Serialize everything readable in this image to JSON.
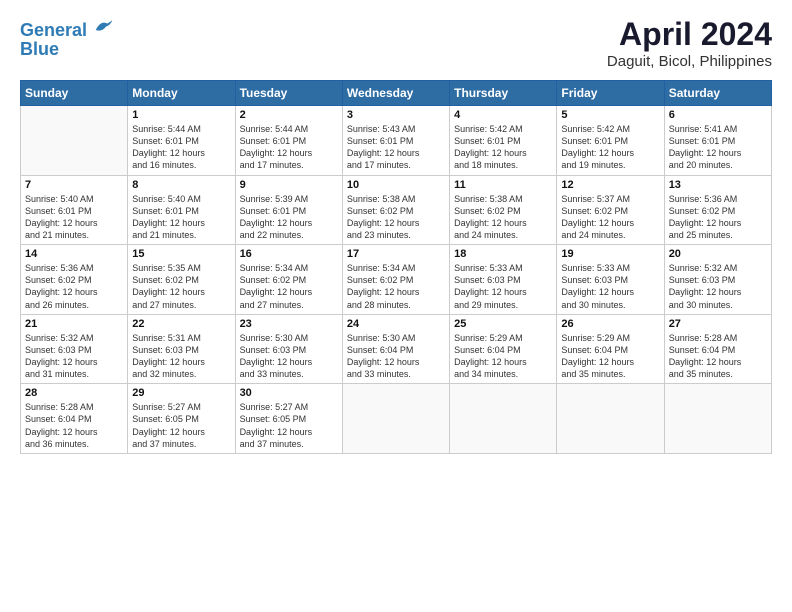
{
  "header": {
    "logo_line1": "General",
    "logo_line2": "Blue",
    "title": "April 2024",
    "subtitle": "Daguit, Bicol, Philippines"
  },
  "days_of_week": [
    "Sunday",
    "Monday",
    "Tuesday",
    "Wednesday",
    "Thursday",
    "Friday",
    "Saturday"
  ],
  "weeks": [
    [
      {
        "day": "",
        "info": ""
      },
      {
        "day": "1",
        "info": "Sunrise: 5:44 AM\nSunset: 6:01 PM\nDaylight: 12 hours\nand 16 minutes."
      },
      {
        "day": "2",
        "info": "Sunrise: 5:44 AM\nSunset: 6:01 PM\nDaylight: 12 hours\nand 17 minutes."
      },
      {
        "day": "3",
        "info": "Sunrise: 5:43 AM\nSunset: 6:01 PM\nDaylight: 12 hours\nand 17 minutes."
      },
      {
        "day": "4",
        "info": "Sunrise: 5:42 AM\nSunset: 6:01 PM\nDaylight: 12 hours\nand 18 minutes."
      },
      {
        "day": "5",
        "info": "Sunrise: 5:42 AM\nSunset: 6:01 PM\nDaylight: 12 hours\nand 19 minutes."
      },
      {
        "day": "6",
        "info": "Sunrise: 5:41 AM\nSunset: 6:01 PM\nDaylight: 12 hours\nand 20 minutes."
      }
    ],
    [
      {
        "day": "7",
        "info": "Sunrise: 5:40 AM\nSunset: 6:01 PM\nDaylight: 12 hours\nand 21 minutes."
      },
      {
        "day": "8",
        "info": "Sunrise: 5:40 AM\nSunset: 6:01 PM\nDaylight: 12 hours\nand 21 minutes."
      },
      {
        "day": "9",
        "info": "Sunrise: 5:39 AM\nSunset: 6:01 PM\nDaylight: 12 hours\nand 22 minutes."
      },
      {
        "day": "10",
        "info": "Sunrise: 5:38 AM\nSunset: 6:02 PM\nDaylight: 12 hours\nand 23 minutes."
      },
      {
        "day": "11",
        "info": "Sunrise: 5:38 AM\nSunset: 6:02 PM\nDaylight: 12 hours\nand 24 minutes."
      },
      {
        "day": "12",
        "info": "Sunrise: 5:37 AM\nSunset: 6:02 PM\nDaylight: 12 hours\nand 24 minutes."
      },
      {
        "day": "13",
        "info": "Sunrise: 5:36 AM\nSunset: 6:02 PM\nDaylight: 12 hours\nand 25 minutes."
      }
    ],
    [
      {
        "day": "14",
        "info": "Sunrise: 5:36 AM\nSunset: 6:02 PM\nDaylight: 12 hours\nand 26 minutes."
      },
      {
        "day": "15",
        "info": "Sunrise: 5:35 AM\nSunset: 6:02 PM\nDaylight: 12 hours\nand 27 minutes."
      },
      {
        "day": "16",
        "info": "Sunrise: 5:34 AM\nSunset: 6:02 PM\nDaylight: 12 hours\nand 27 minutes."
      },
      {
        "day": "17",
        "info": "Sunrise: 5:34 AM\nSunset: 6:02 PM\nDaylight: 12 hours\nand 28 minutes."
      },
      {
        "day": "18",
        "info": "Sunrise: 5:33 AM\nSunset: 6:03 PM\nDaylight: 12 hours\nand 29 minutes."
      },
      {
        "day": "19",
        "info": "Sunrise: 5:33 AM\nSunset: 6:03 PM\nDaylight: 12 hours\nand 30 minutes."
      },
      {
        "day": "20",
        "info": "Sunrise: 5:32 AM\nSunset: 6:03 PM\nDaylight: 12 hours\nand 30 minutes."
      }
    ],
    [
      {
        "day": "21",
        "info": "Sunrise: 5:32 AM\nSunset: 6:03 PM\nDaylight: 12 hours\nand 31 minutes."
      },
      {
        "day": "22",
        "info": "Sunrise: 5:31 AM\nSunset: 6:03 PM\nDaylight: 12 hours\nand 32 minutes."
      },
      {
        "day": "23",
        "info": "Sunrise: 5:30 AM\nSunset: 6:03 PM\nDaylight: 12 hours\nand 33 minutes."
      },
      {
        "day": "24",
        "info": "Sunrise: 5:30 AM\nSunset: 6:04 PM\nDaylight: 12 hours\nand 33 minutes."
      },
      {
        "day": "25",
        "info": "Sunrise: 5:29 AM\nSunset: 6:04 PM\nDaylight: 12 hours\nand 34 minutes."
      },
      {
        "day": "26",
        "info": "Sunrise: 5:29 AM\nSunset: 6:04 PM\nDaylight: 12 hours\nand 35 minutes."
      },
      {
        "day": "27",
        "info": "Sunrise: 5:28 AM\nSunset: 6:04 PM\nDaylight: 12 hours\nand 35 minutes."
      }
    ],
    [
      {
        "day": "28",
        "info": "Sunrise: 5:28 AM\nSunset: 6:04 PM\nDaylight: 12 hours\nand 36 minutes."
      },
      {
        "day": "29",
        "info": "Sunrise: 5:27 AM\nSunset: 6:05 PM\nDaylight: 12 hours\nand 37 minutes."
      },
      {
        "day": "30",
        "info": "Sunrise: 5:27 AM\nSunset: 6:05 PM\nDaylight: 12 hours\nand 37 minutes."
      },
      {
        "day": "",
        "info": ""
      },
      {
        "day": "",
        "info": ""
      },
      {
        "day": "",
        "info": ""
      },
      {
        "day": "",
        "info": ""
      }
    ]
  ]
}
